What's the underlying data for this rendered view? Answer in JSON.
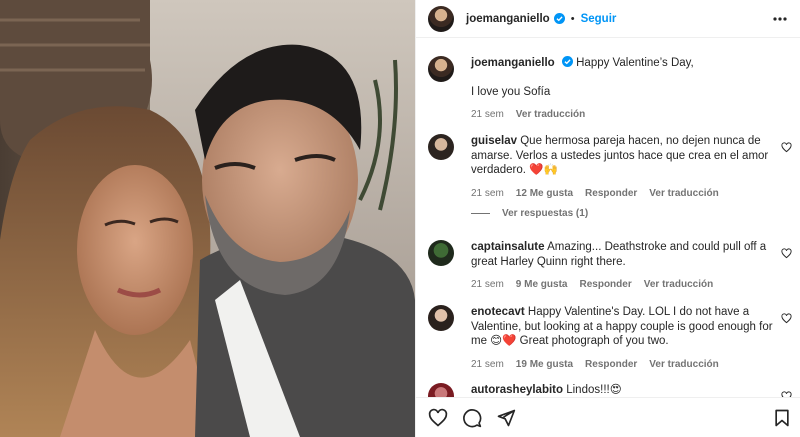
{
  "header": {
    "username": "joemanganiello",
    "separator": "•",
    "follow_label": "Seguir"
  },
  "caption": {
    "username": "joemanganiello",
    "text_line1": "Happy Valentine’s Day,",
    "text_line2": "I love you Sofía",
    "time": "21 sem",
    "translate": "Ver traducción"
  },
  "comments": [
    {
      "username": "guiselav",
      "text": "Que hermosa pareja hacen, no dejen nunca de amarse. Verlos a ustedes juntos hace que crea en el amor verdadero. ❤️🙌",
      "time": "21 sem",
      "likes": "12 Me gusta",
      "reply": "Responder",
      "translate": "Ver traducción",
      "view_replies": "Ver respuestas (1)"
    },
    {
      "username": "captainsalute",
      "text": "Amazing... Deathstroke and could pull off a great Harley Quinn right there.",
      "time": "21 sem",
      "likes": "9 Me gusta",
      "reply": "Responder",
      "translate": "Ver traducción"
    },
    {
      "username": "enotecavt",
      "text": "Happy Valentine's Day. LOL I do not have a Valentine, but looking at a happy couple is good enough for me 😊❤️ Great photograph of you two.",
      "time": "21 sem",
      "likes": "19 Me gusta",
      "reply": "Responder",
      "translate": "Ver traducción"
    },
    {
      "username": "autorasheylabito",
      "text": "Lindos!!!😍"
    }
  ],
  "icons": {
    "verified": "verified-badge-icon",
    "more": "more-options-icon",
    "like": "heart-icon",
    "comment": "comment-icon",
    "share": "share-icon",
    "save": "bookmark-icon"
  },
  "colors": {
    "link_blue": "#0095f6",
    "verified_blue": "#0095f6",
    "meta_gray": "#737373"
  }
}
